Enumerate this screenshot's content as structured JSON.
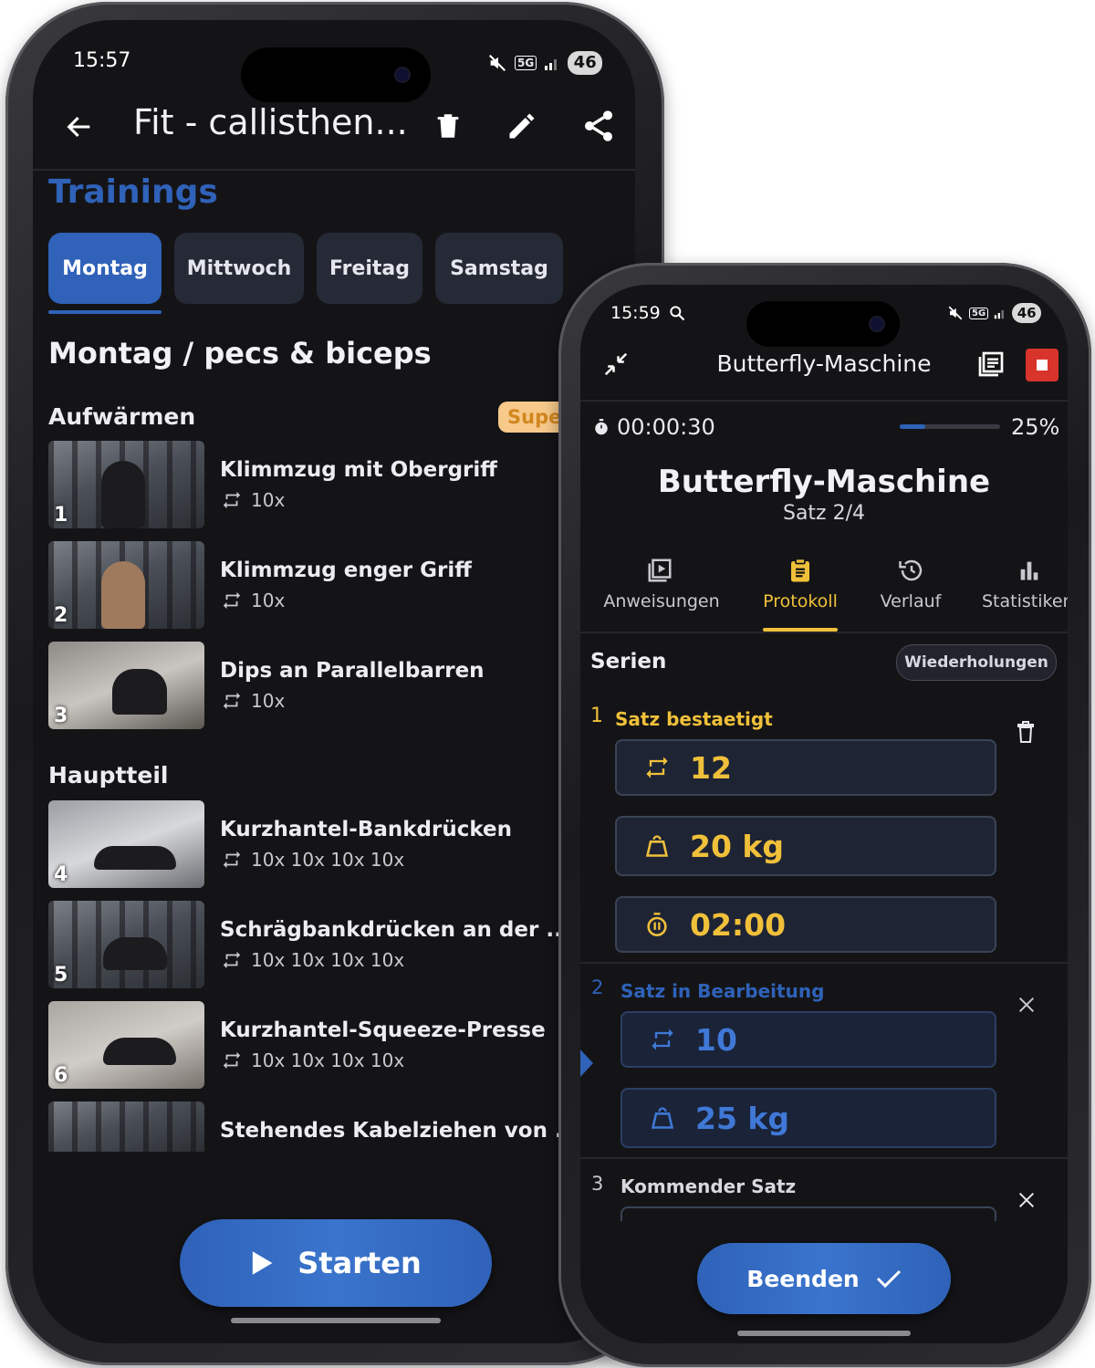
{
  "phone1": {
    "status": {
      "time": "15:57",
      "battery": "46",
      "network": "5G"
    },
    "appbar": {
      "title": "Fit - callisthen..."
    },
    "section_title": "Trainings",
    "day_tabs": [
      {
        "label": "Montag",
        "active": true
      },
      {
        "label": "Mittwoch",
        "active": false
      },
      {
        "label": "Freitag",
        "active": false
      },
      {
        "label": "Samstag",
        "active": false
      }
    ],
    "workout_title": "Montag / pecs & biceps",
    "groups": {
      "warmup": {
        "label": "Aufwärmen",
        "badge": "Supe"
      },
      "main": {
        "label": "Hauptteil"
      }
    },
    "exercises": [
      {
        "num": "1",
        "name": "Klimmzug mit Obergriff",
        "reps": "10x"
      },
      {
        "num": "2",
        "name": "Klimmzug enger Griff",
        "reps": "10x"
      },
      {
        "num": "3",
        "name": "Dips an Parallelbarren",
        "reps": "10x"
      },
      {
        "num": "4",
        "name": "Kurzhantel-Bankdrücken",
        "reps": "10x 10x 10x 10x"
      },
      {
        "num": "5",
        "name": "Schrägbankdrücken an der ...",
        "reps": "10x 10x 10x 10x"
      },
      {
        "num": "6",
        "name": "Kurzhantel-Squeeze-Presse",
        "reps": "10x 10x 10x 10x"
      },
      {
        "num": "",
        "name": "Stehendes Kabelziehen von ...",
        "reps": ""
      }
    ],
    "start_button": "Starten"
  },
  "phone2": {
    "status": {
      "time": "15:59",
      "battery": "46",
      "network": "5G"
    },
    "appbar": {
      "title": "Butterfly-Maschine"
    },
    "timer": "00:00:30",
    "progress": {
      "percent": 25,
      "label": "25%"
    },
    "exercise_title": "Butterfly-Maschine",
    "set_label": "Satz 2/4",
    "tabs": [
      {
        "label": "Anweisungen",
        "icon": "video-library-icon",
        "active": false
      },
      {
        "label": "Protokoll",
        "icon": "clipboard-icon",
        "active": true
      },
      {
        "label": "Verlauf",
        "icon": "history-icon",
        "active": false
      },
      {
        "label": "Statistiken",
        "icon": "bar-chart-icon",
        "active": false
      }
    ],
    "series_heading": "Serien",
    "reps_chip": "Wiederholungen",
    "sets": [
      {
        "num": "1",
        "status": "Satz bestaetigt",
        "reps": "12",
        "weight": "20 kg",
        "rest": "02:00"
      },
      {
        "num": "2",
        "status": "Satz in Bearbeitung",
        "reps": "10",
        "weight": "25 kg"
      },
      {
        "num": "3",
        "status": "Kommender Satz"
      }
    ],
    "finish_button": "Beenden",
    "colors": {
      "accent_yellow": "#f0c03a",
      "accent_blue": "#2f62b8",
      "stop_red": "#d9342b"
    }
  }
}
